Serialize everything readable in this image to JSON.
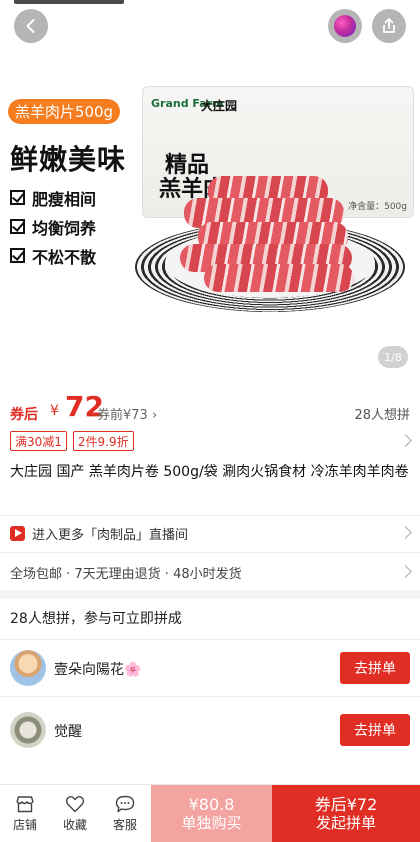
{
  "hero": {
    "promo_tag": "羔羊肉片500g",
    "headline": "鲜嫩美味",
    "features": [
      "肥瘦相间",
      "均衡饲养",
      "不松不散"
    ],
    "bag": {
      "logo": "Grand Farm",
      "brand": "大庄园",
      "title_line1": "精品",
      "title_line2": "羔羊肉",
      "weight": "净含量：500g"
    },
    "image_indicator": "1/8"
  },
  "price": {
    "label": "券后",
    "currency": "¥",
    "value": "72",
    "original": "券前¥73 ›",
    "want_count": "28人想拼"
  },
  "coupons": [
    "满30减1",
    "2件9.9折"
  ],
  "product_title": "大庄园 国产 羔羊肉片卷 500g/袋 涮肉火锅食材 冷冻羊肉羊肉卷",
  "live": {
    "text": "进入更多「肉制品」直播间"
  },
  "service": {
    "text": "全场包邮 · 7天无理由退货 · 48小时发货"
  },
  "group": {
    "header": "28人想拼，参与可立即拼成",
    "members": [
      {
        "name": "壹朵向陽花🌸",
        "action": "去拼单"
      },
      {
        "name": "觉醒",
        "action": "去拼单"
      }
    ]
  },
  "bottom": {
    "nav": [
      {
        "label": "店铺",
        "icon": "store-icon"
      },
      {
        "label": "收藏",
        "icon": "heart-icon"
      },
      {
        "label": "客服",
        "icon": "chat-icon"
      }
    ],
    "solo": {
      "price": "¥80.8",
      "label": "单独购买"
    },
    "group_buy": {
      "price": "券后¥72",
      "label": "发起拼单"
    }
  },
  "colors": {
    "accent": "#e02e24",
    "promo": "#f57c1f",
    "solo_button": "#f3a3a0"
  }
}
